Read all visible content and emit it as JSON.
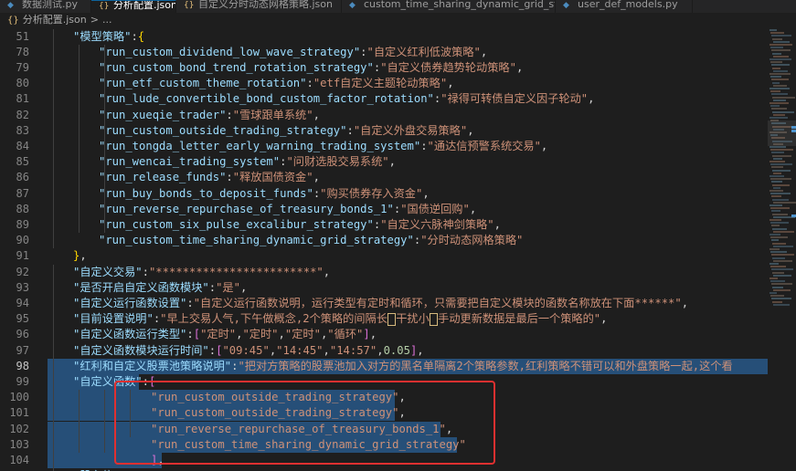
{
  "tabs": [
    {
      "label": "数据测试.py",
      "icon": "python-icon",
      "active": false
    },
    {
      "label": "分析配置.json",
      "icon": "json-icon",
      "active": true
    },
    {
      "label": "自定义分时动态网格策略.json",
      "icon": "json-icon",
      "active": false
    },
    {
      "label": "custom_time_sharing_dynamic_grid_strategy.py",
      "icon": "python-icon",
      "active": false
    },
    {
      "label": "user_def_models.py",
      "icon": "python-icon",
      "active": false
    }
  ],
  "breadcrumb": {
    "file": "分析配置.json",
    "sep": ">",
    "rest": "..."
  },
  "editor": {
    "current_line": "98",
    "lines": [
      {
        "n": "51",
        "tokens": [
          [
            "k",
            "\"模型策略\""
          ],
          [
            "p",
            ":"
          ],
          [
            "b1",
            "{"
          ]
        ]
      },
      {
        "n": "78",
        "tokens": [
          [
            "k",
            "\"run_custom_dividend_low_wave_strategy\""
          ],
          [
            "p",
            ":"
          ],
          [
            "s",
            "\"自定义红利低波策略\""
          ],
          [
            "p",
            ","
          ]
        ]
      },
      {
        "n": "79",
        "tokens": [
          [
            "k",
            "\"run_custom_bond_trend_rotation_strategy\""
          ],
          [
            "p",
            ":"
          ],
          [
            "s",
            "\"自定义债券趋势轮动策略\""
          ],
          [
            "p",
            ","
          ]
        ]
      },
      {
        "n": "80",
        "tokens": [
          [
            "k",
            "\"run_etf_custom_theme_rotation\""
          ],
          [
            "p",
            ":"
          ],
          [
            "s",
            "\"etf自定义主题轮动策略\""
          ],
          [
            "p",
            ","
          ]
        ]
      },
      {
        "n": "81",
        "tokens": [
          [
            "k",
            "\"run_lude_convertible_bond_custom_factor_rotation\""
          ],
          [
            "p",
            ":"
          ],
          [
            "s",
            "\"禄得可转债自定义因子轮动\""
          ],
          [
            "p",
            ","
          ]
        ]
      },
      {
        "n": "82",
        "tokens": [
          [
            "k",
            "\"run_xueqie_trader\""
          ],
          [
            "p",
            ":"
          ],
          [
            "s",
            "\"雪球跟单系统\""
          ],
          [
            "p",
            ","
          ]
        ]
      },
      {
        "n": "83",
        "tokens": [
          [
            "k",
            "\"run_custom_outside_trading_strategy\""
          ],
          [
            "p",
            ":"
          ],
          [
            "s",
            "\"自定义外盘交易策略\""
          ],
          [
            "p",
            ","
          ]
        ]
      },
      {
        "n": "84",
        "tokens": [
          [
            "k",
            "\"run_tongda_letter_early_warning_trading_system\""
          ],
          [
            "p",
            ":"
          ],
          [
            "s",
            "\"通达信预警系统交易\""
          ],
          [
            "p",
            ","
          ]
        ]
      },
      {
        "n": "85",
        "tokens": [
          [
            "k",
            "\"run_wencai_trading_system\""
          ],
          [
            "p",
            ":"
          ],
          [
            "s",
            "\"问财选股交易系统\""
          ],
          [
            "p",
            ","
          ]
        ]
      },
      {
        "n": "86",
        "tokens": [
          [
            "k",
            "\"run_release_funds\""
          ],
          [
            "p",
            ":"
          ],
          [
            "s",
            "\"释放国债资金\""
          ],
          [
            "p",
            ","
          ]
        ]
      },
      {
        "n": "87",
        "tokens": [
          [
            "k",
            "\"run_buy_bonds_to_deposit_funds\""
          ],
          [
            "p",
            ":"
          ],
          [
            "s",
            "\"购买债券存入资金\""
          ],
          [
            "p",
            ","
          ]
        ]
      },
      {
        "n": "88",
        "tokens": [
          [
            "k",
            "\"run_reverse_repurchase_of_treasury_bonds_1\""
          ],
          [
            "p",
            ":"
          ],
          [
            "s",
            "\"国债逆回购\""
          ],
          [
            "p",
            ","
          ]
        ]
      },
      {
        "n": "89",
        "tokens": [
          [
            "k",
            "\"run_custom_six_pulse_excalibur_strategy\""
          ],
          [
            "p",
            ":"
          ],
          [
            "s",
            "\"自定义六脉神剑策略\""
          ],
          [
            "p",
            ","
          ]
        ]
      },
      {
        "n": "90",
        "tokens": [
          [
            "k",
            "\"run_custom_time_sharing_dynamic_grid_strategy\""
          ],
          [
            "p",
            ":"
          ],
          [
            "s",
            "\"分时动态网格策略\""
          ]
        ]
      },
      {
        "n": "91",
        "tokens": [
          [
            "b1",
            "}"
          ],
          [
            "p",
            ","
          ]
        ]
      },
      {
        "n": "92",
        "tokens": [
          [
            "k",
            "\"自定义交易\""
          ],
          [
            "p",
            ":"
          ],
          [
            "s",
            "\"************************\""
          ],
          [
            "p",
            ","
          ]
        ]
      },
      {
        "n": "93",
        "tokens": [
          [
            "k",
            "\"是否开启自定义函数模块\""
          ],
          [
            "p",
            ":"
          ],
          [
            "s",
            "\"是\""
          ],
          [
            "p",
            ","
          ]
        ]
      },
      {
        "n": "94",
        "tokens": [
          [
            "k",
            "\"自定义运行函数设置\""
          ],
          [
            "p",
            ":"
          ],
          [
            "s",
            "\"自定义运行函数说明，运行类型有定时和循环，只需要把自定义模块的函数名称放在下面******\""
          ],
          [
            "p",
            ","
          ]
        ]
      },
      {
        "n": "95",
        "tokens": [
          [
            "k",
            "\"目前设置说明\""
          ],
          [
            "p",
            ":"
          ],
          [
            "s",
            "\"早上交易人气,下午做概念,2个策略的间隔长"
          ],
          [
            "o",
            " "
          ],
          [
            "s",
            "干扰小"
          ],
          [
            "o",
            " "
          ],
          [
            "s",
            "手动更新数据是最后一个策略的\""
          ],
          [
            "p",
            ","
          ]
        ]
      },
      {
        "n": "96",
        "tokens": [
          [
            "k",
            "\"自定义函数运行类型\""
          ],
          [
            "p",
            ":"
          ],
          [
            "b2",
            "["
          ],
          [
            "s",
            "\"定时\""
          ],
          [
            "p",
            ","
          ],
          [
            "s",
            "\"定时\""
          ],
          [
            "p",
            ","
          ],
          [
            "s",
            "\"定时\""
          ],
          [
            "p",
            ","
          ],
          [
            "s",
            "\"循环\""
          ],
          [
            "b2",
            "]"
          ],
          [
            "p",
            ","
          ]
        ]
      },
      {
        "n": "97",
        "tokens": [
          [
            "k",
            "\"自定义函数模块运行时间\""
          ],
          [
            "p",
            ":"
          ],
          [
            "b2",
            "["
          ],
          [
            "s",
            "\"09:45\""
          ],
          [
            "p",
            ","
          ],
          [
            "s",
            "\"14:45\""
          ],
          [
            "p",
            ","
          ],
          [
            "s",
            "\"14:57\""
          ],
          [
            "p",
            ","
          ],
          [
            "n",
            "0.05"
          ],
          [
            "b2",
            "]"
          ],
          [
            "p",
            ","
          ]
        ]
      },
      {
        "n": "98",
        "tokens": [
          [
            "k",
            "\"红利和自定义股票池策略说明\""
          ],
          [
            "p",
            ":"
          ],
          [
            "s",
            "\"把对方策略的股票池加入对方的黑名单隔离2个策略参数,红利策略不错可以和外盘策略一起,这个看"
          ]
        ]
      },
      {
        "n": "99",
        "tokens": [
          [
            "k",
            "\"自定义函数\""
          ],
          [
            "p",
            ":"
          ],
          [
            "b2",
            "["
          ]
        ]
      },
      {
        "n": "100",
        "tokens": [
          [
            "s",
            "\"run_custom_outside_trading_strategy\""
          ],
          [
            "p",
            ","
          ]
        ]
      },
      {
        "n": "101",
        "tokens": [
          [
            "s",
            "\"run_custom_outside_trading_strategy\""
          ],
          [
            "p",
            ","
          ]
        ]
      },
      {
        "n": "102",
        "tokens": [
          [
            "s",
            "\"run_reverse_repurchase_of_treasury_bonds_1\""
          ],
          [
            "p",
            ","
          ]
        ]
      },
      {
        "n": "103",
        "tokens": [
          [
            "s",
            "\"run_custom_time_sharing_dynamic_grid_strategy\""
          ]
        ]
      },
      {
        "n": "104",
        "tokens": [
          [
            "b2",
            "]"
          ],
          [
            "p",
            ","
          ]
        ]
      },
      {
        "n": "",
        "tokens": [
          [
            "k",
            "\"股东信\""
          ],
          [
            "p",
            ":"
          ],
          [
            "s",
            "\"***\""
          ]
        ]
      }
    ]
  },
  "colors": {
    "accent": "#0e639c",
    "selection": "#264f78",
    "annotation": "#e03030"
  }
}
